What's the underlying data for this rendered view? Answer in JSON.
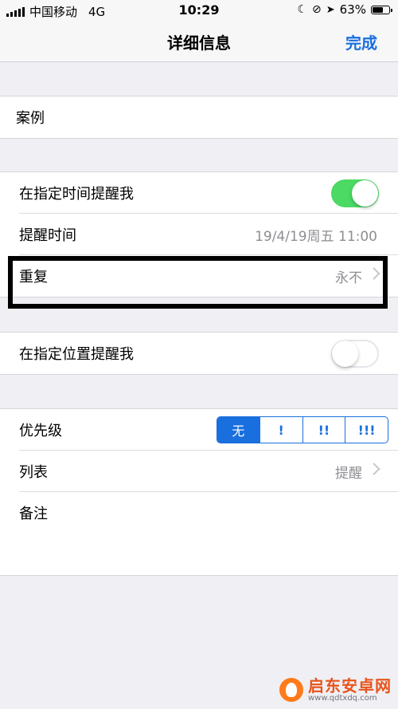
{
  "status_bar": {
    "carrier": "中国移动",
    "network": "4G",
    "time": "10:29",
    "battery": "63%",
    "battery_level": 0.63
  },
  "nav": {
    "title": "详细信息",
    "done": "完成"
  },
  "title_group": {
    "title": "案例"
  },
  "time_group": {
    "remind_at_time_label": "在指定时间提醒我",
    "remind_at_time_on": true,
    "remind_time_label": "提醒时间",
    "remind_time_value": "19/4/19周五 11:00",
    "repeat_label": "重复",
    "repeat_value": "永不"
  },
  "location_group": {
    "remind_at_location_label": "在指定位置提醒我",
    "remind_at_location_on": false
  },
  "details_group": {
    "priority_label": "优先级",
    "priority_options": [
      "无",
      "!",
      "!!",
      "!!!"
    ],
    "priority_selected": "无",
    "list_label": "列表",
    "list_value": "提醒",
    "notes_label": "备注"
  },
  "watermark": {
    "text": "启东安卓网",
    "url": "www.qdtxdq.com"
  },
  "colors": {
    "accent": "#1a6fde",
    "toggle_on": "#4cd964",
    "background": "#efeff4"
  }
}
